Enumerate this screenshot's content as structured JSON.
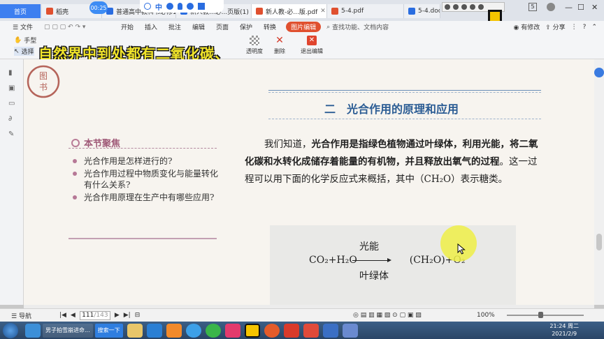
{
  "tabs": {
    "home": "首页",
    "items": [
      {
        "label": "稻壳",
        "color": "#e0502f"
      },
      {
        "label": "普通高中教科书必修1",
        "color": "#2a6de0"
      },
      {
        "label": "新人教...必...页版(1)",
        "color": "#2a6de0"
      },
      {
        "label": "新人教-必...版.pdf",
        "color": "#e0502f",
        "active": true
      },
      {
        "label": "5-4.pdf",
        "color": "#e0502f"
      },
      {
        "label": "5-4.docx",
        "color": "#2a6de0"
      }
    ],
    "timer": "00:25",
    "page_badge": "5"
  },
  "menu": {
    "file": "文件",
    "items": [
      "开始",
      "插入",
      "批注",
      "编辑",
      "页面",
      "保护",
      "转换"
    ],
    "active": "图片编辑",
    "search_placeholder": "查找功能、文档内容",
    "right": [
      "有修改",
      "分享"
    ]
  },
  "toolbar": {
    "hand": "手型",
    "select": "选择",
    "transparency": "透明度",
    "delete": "删除",
    "exit": "退出编辑"
  },
  "overlay_caption": "自然界中到处都有二氧化碳、",
  "page": {
    "section_title": "二　光合作用的原理和应用",
    "focus_title": "本节聚焦",
    "focus_items": [
      "光合作用是怎样进行的?",
      "光合作用过程中物质变化与能量转化有什么关系?",
      "光合作用原理在生产中有哪些应用?"
    ],
    "para_lead": "我们知道，",
    "para_bold": "光合作用是指绿色植物通过叶绿体，利用光能，将二氧化碳和水转化成储存着能量的有机物，并且释放出氧气的过程",
    "para_tail": "。这一过程可以用下面的化学反应式来概括，其中（CH₂O）表示糖类。",
    "equation": {
      "left": "CO₂+H₂O",
      "above": "光能",
      "below": "叶绿体",
      "right": "(CH₂O)+O₂"
    }
  },
  "status": {
    "nav": "导航",
    "page_current": "111",
    "page_total": "/143",
    "zoom": "100%"
  },
  "taskbar": {
    "apps": [
      "男子拍雪崩进命...",
      "搜索一下"
    ],
    "time": "21:24 周二",
    "date": "2021/2/9"
  }
}
